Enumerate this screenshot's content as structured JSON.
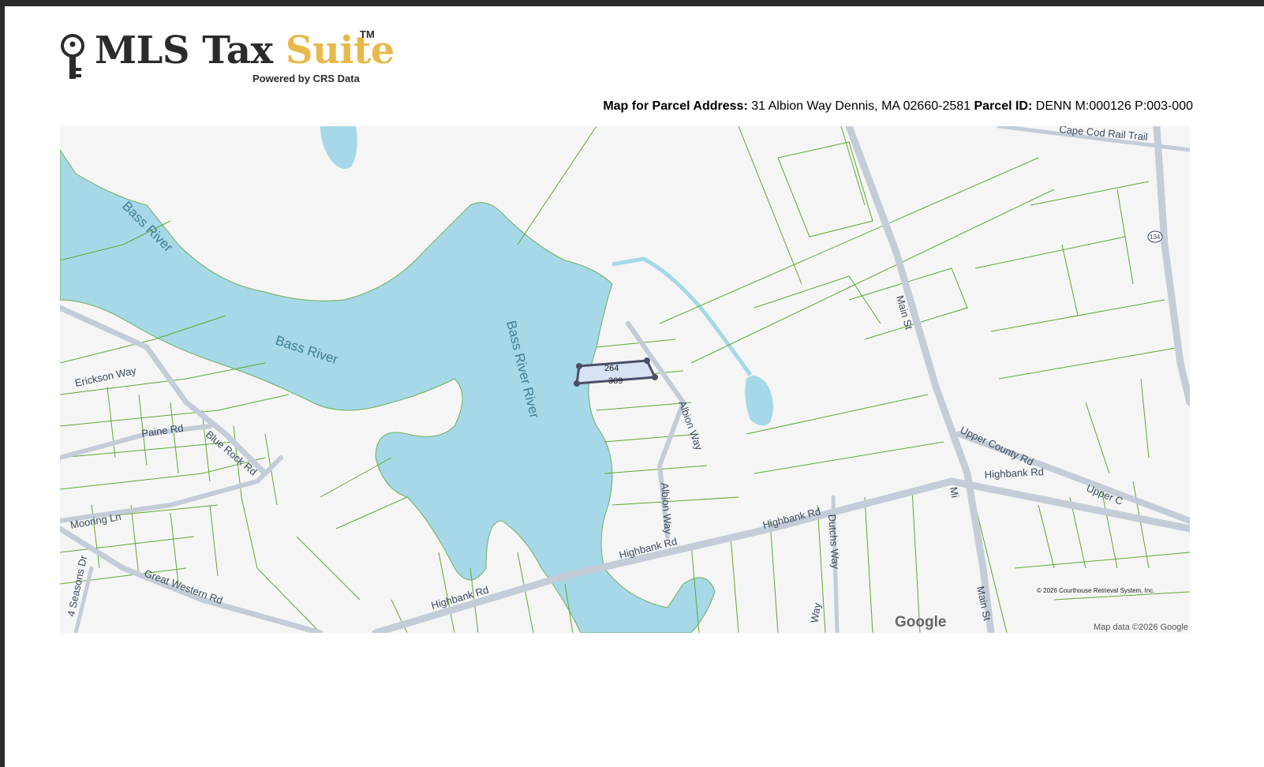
{
  "header": {
    "logo_title_part1": "MLS Tax ",
    "logo_title_part2": "Suite",
    "logo_tm": "TM",
    "logo_subtitle": "Powered by CRS Data",
    "map_for_label": "Map for Parcel Address:",
    "address": "31 Albion Way Dennis, MA 02660-2581",
    "parcel_id_label": "Parcel ID:",
    "parcel_id": "DENN M:000126 P:003-000"
  },
  "map": {
    "water_labels": [
      "Bass River",
      "Bass River",
      "Bass River River"
    ],
    "road_labels": {
      "erickson": "Erickson Way",
      "paine": "Paine Rd",
      "blue_rock": "Blue Rock Rd",
      "mooring": "Mooring Ln",
      "great_western": "Great Western Rd",
      "four_seasons": "4 Seasons Dr",
      "highbank1": "Highbank Rd",
      "highbank2": "Highbank Rd",
      "highbank3": "Highbank Rd",
      "highbank4": "Highbank Rd",
      "albion1": "Albion Way",
      "albion2": "Albion Way",
      "dutchs": "Dutchs Way",
      "main1": "Main St",
      "main2": "Main St",
      "main3": "Mi",
      "upper_county": "Upper County Rd",
      "upper_c": "Upper C",
      "rail_trail": "Cape Cod Rail Trail",
      "route": "134",
      "way": "Way"
    },
    "parcel": {
      "dim_top": "264",
      "dim_bottom": "309"
    },
    "copyright": "© 2026 Courthouse Retrieval System, Inc.",
    "attribution": "Map data ©2026 Google",
    "google_logo": "Google"
  },
  "colors": {
    "water": "#a6d8e7",
    "land": "#f5f5f5",
    "parcel_line": "#5ea832",
    "road": "#c4ccd8",
    "parcel_fill": "#d8e2f5",
    "brand_gold": "#e8b94a"
  }
}
